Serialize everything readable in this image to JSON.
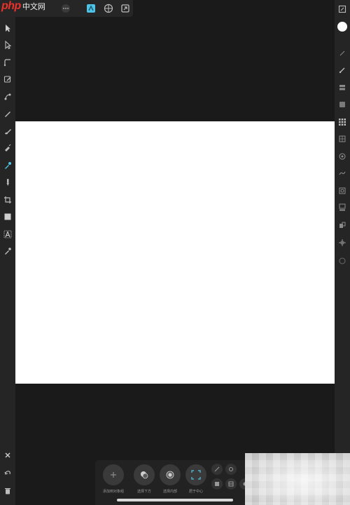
{
  "app": {
    "logo_php": "php",
    "logo_cn": "中文网"
  },
  "colors": {
    "toolbar_bg": "#252525",
    "workspace_bg": "#1a1a1a",
    "canvas_bg": "#ffffff",
    "icon": "#bdbdbd",
    "accent": "#4fc3e6",
    "color_well": "#ffffff"
  },
  "left_tools": [
    {
      "name": "move-tool-icon"
    },
    {
      "name": "node-tool-icon"
    },
    {
      "name": "corner-tool-icon"
    },
    {
      "name": "pen-tool-icon"
    },
    {
      "name": "node-edit-icon"
    },
    {
      "name": "pencil-tool-icon"
    },
    {
      "name": "vector-brush-icon"
    },
    {
      "name": "fill-tool-icon"
    },
    {
      "name": "color-picker-icon"
    },
    {
      "name": "brush-tool-icon"
    },
    {
      "name": "crop-tool-icon"
    },
    {
      "name": "rectangle-tool-icon"
    },
    {
      "name": "text-tool-icon"
    },
    {
      "name": "eyedropper-icon"
    }
  ],
  "bottom_left_tools": [
    {
      "name": "close-icon"
    },
    {
      "name": "undo-icon"
    },
    {
      "name": "trash-icon"
    }
  ],
  "right_tools": [
    {
      "name": "document-icon"
    },
    {
      "name": "color-well"
    },
    {
      "name": "swatches-icon"
    },
    {
      "name": "brushes-icon"
    },
    {
      "name": "layers-icon"
    },
    {
      "name": "effects-icon"
    },
    {
      "name": "grid-icon"
    },
    {
      "name": "transform-icon"
    },
    {
      "name": "stock-icon"
    },
    {
      "name": "history-icon"
    },
    {
      "name": "navigator-icon"
    },
    {
      "name": "text-styles-icon"
    },
    {
      "name": "glyphs-icon"
    },
    {
      "name": "assets-icon"
    },
    {
      "name": "constraints-icon"
    }
  ],
  "context_bar": {
    "add_label": "添加到对象组",
    "select_under_label": "选择下方",
    "select_inside_label": "选择内部",
    "center_label": "居于中心"
  }
}
